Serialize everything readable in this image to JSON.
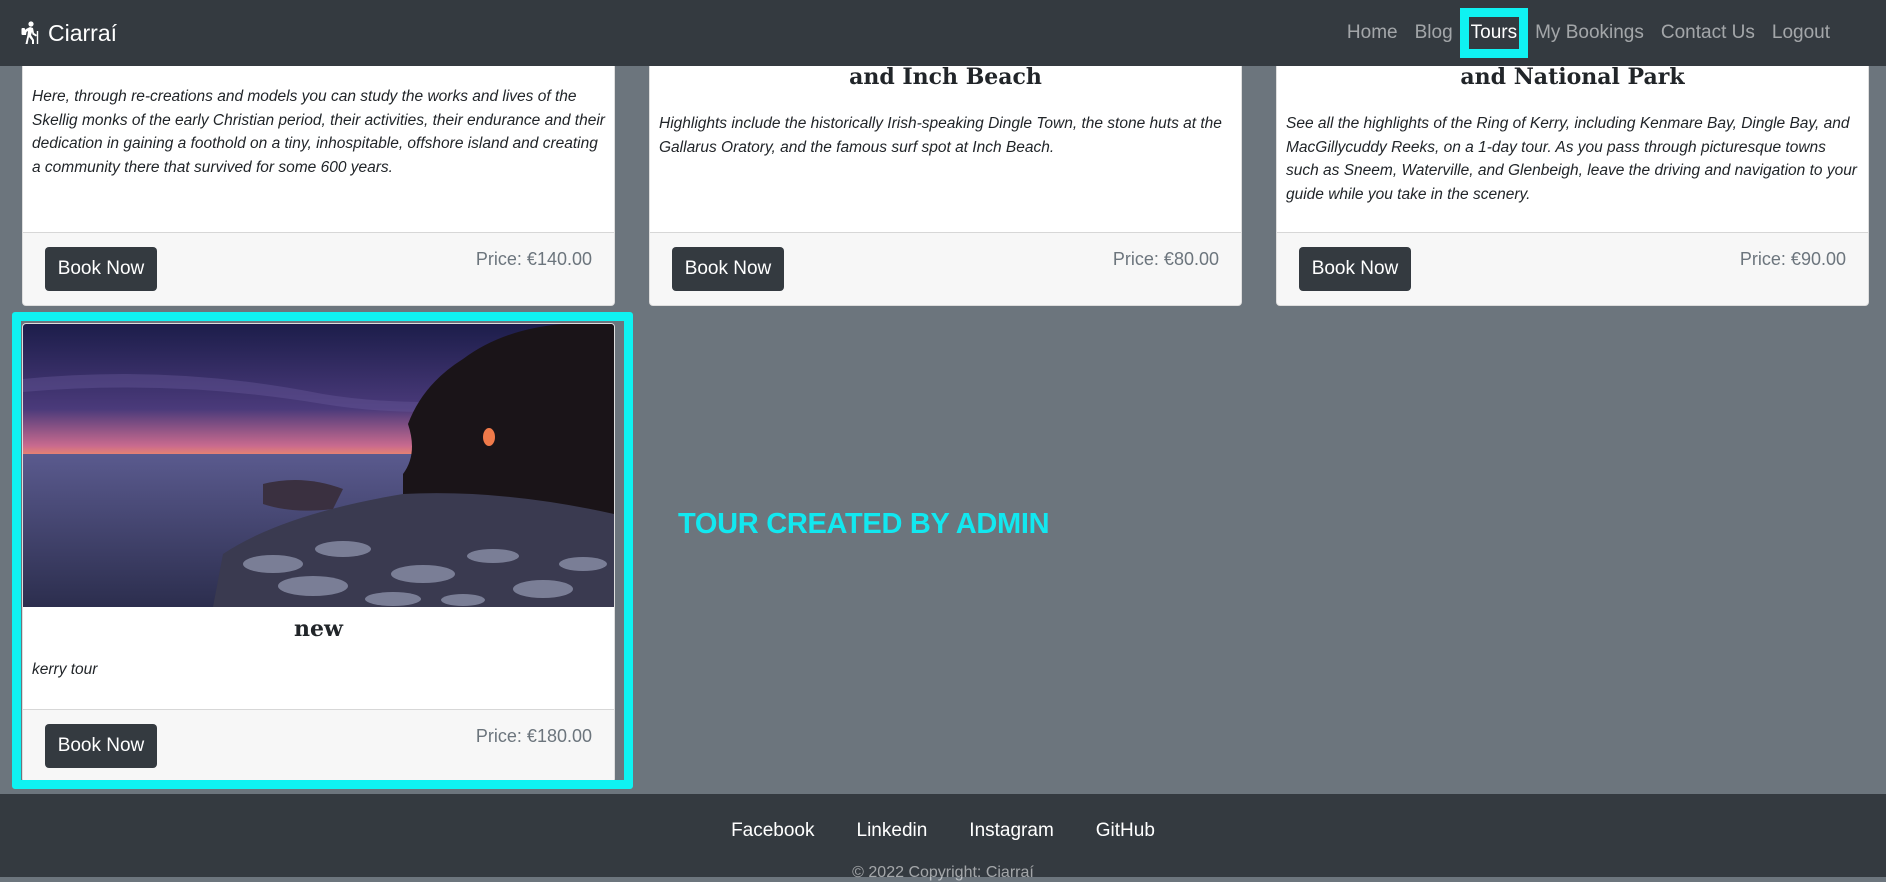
{
  "navbar": {
    "brand": "Ciarraí",
    "links": [
      "Home",
      "Blog",
      "Tours",
      "My Bookings",
      "Contact Us",
      "Logout"
    ],
    "active_link": "Tours"
  },
  "cards": [
    {
      "title": "",
      "text": "Here, through re-creations and models you can study the works and lives of the Skellig monks of the early Christian period, their activities, their endurance and their dedication in gaining a foothold on a tiny, inhospitable, offshore island and creating a community there that survived for some 600 years.",
      "button": "Book Now",
      "price": "Price: €140.00"
    },
    {
      "title": "and Inch Beach",
      "text": "Highlights include the historically Irish-speaking Dingle Town, the stone huts at the Gallarus Oratory, and the famous surf spot at Inch Beach.",
      "button": "Book Now",
      "price": "Price: €80.00"
    },
    {
      "title": "and National Park",
      "text": "See all the highlights of the Ring of Kerry, including Kenmare Bay, Dingle Bay, and MacGillycuddy Reeks, on a 1-day tour. As you pass through picturesque towns such as Sneem, Waterville, and Glenbeigh, leave the driving and navigation to your guide while you take in the scenery.",
      "button": "Book Now",
      "price": "Price: €90.00"
    },
    {
      "title": "new",
      "text": "kerry tour",
      "button": "Book Now",
      "price": "Price: €180.00"
    }
  ],
  "annotation": "TOUR CREATED BY ADMIN",
  "footer": {
    "links": [
      "Facebook",
      "Linkedin",
      "Instagram",
      "GitHub"
    ],
    "copyright": "© 2022 Copyright: Ciarraí"
  },
  "colors": {
    "navbar_bg": "#343a40",
    "page_bg": "#6c757d",
    "highlight": "#0ff2f2",
    "button_bg": "#343a40"
  },
  "icons": {
    "brand": "hiking-person-icon"
  }
}
